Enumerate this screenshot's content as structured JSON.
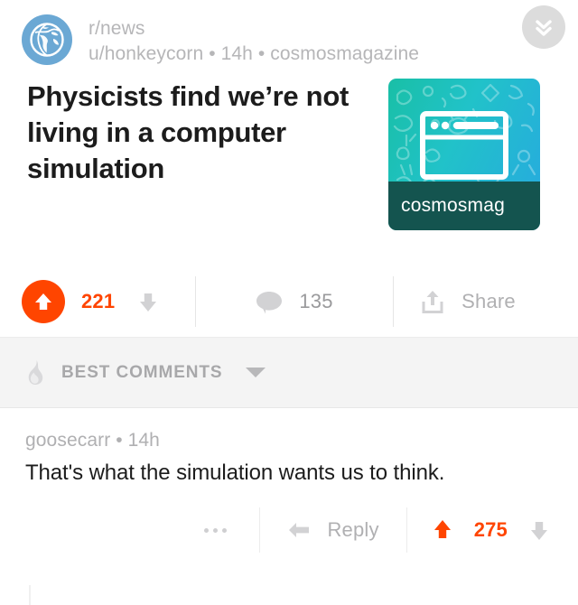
{
  "post": {
    "subreddit": "r/news",
    "byline": "u/honkeycorn • 14h • cosmosmagazine",
    "author": "u/honkeycorn",
    "age": "14h",
    "domain": "cosmosmagazine",
    "title": "Physicists find we’re not living in a computer simulation",
    "avatar_icon": "globe-icon",
    "collapse_icon": "double-chevron-down-icon",
    "thumbnail": {
      "footer_text": "cosmosmag",
      "icon": "browser-window-icon",
      "gradient_start": "#19bfa6",
      "gradient_end": "#27a9e0",
      "footer_color": "#14544f"
    },
    "actions": {
      "upvote_icon": "upvote-arrow-icon",
      "score": "221",
      "downvote_icon": "downvote-arrow-icon",
      "comment_icon": "comment-bubble-icon",
      "comment_count": "135",
      "share_icon": "share-icon",
      "share_label": "Share"
    }
  },
  "sort": {
    "icon": "flame-icon",
    "label": "BEST COMMENTS",
    "caret_icon": "caret-down-icon"
  },
  "comments": [
    {
      "author": "goosecarr",
      "age": "14h",
      "meta": "goosecarr • 14h",
      "body": "That's what the simulation wants us to think.",
      "overflow_icon": "more-options-icon",
      "reply_icon": "reply-arrow-icon",
      "reply_label": "Reply",
      "upvote_icon": "upvote-arrow-icon",
      "score": "275",
      "downvote_icon": "downvote-arrow-icon"
    }
  ],
  "colors": {
    "accent_orange": "#ff4500",
    "muted_gray": "#b0b0b2",
    "sort_bar_bg": "#f4f4f4",
    "avatar_blue": "#6ba8d4"
  }
}
